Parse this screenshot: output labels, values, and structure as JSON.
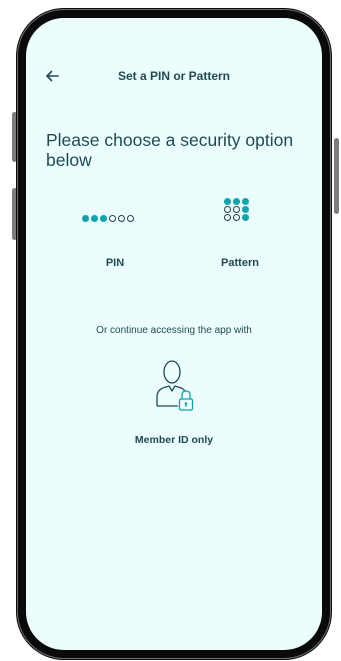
{
  "header": {
    "back_icon": "arrow-left-icon",
    "title": "Set a PIN or Pattern"
  },
  "heading": "Please choose a security option below",
  "options": {
    "pin": {
      "label": "PIN",
      "icon": "pin-dots-icon",
      "filled_dots": 3,
      "total_dots": 6
    },
    "pattern": {
      "label": "Pattern",
      "icon": "pattern-grid-icon"
    }
  },
  "continue_text": "Or continue accessing the app with",
  "member": {
    "label": "Member ID only",
    "icon": "user-lock-icon"
  },
  "colors": {
    "accent": "#0aa5aa",
    "text": "#1f4a52",
    "background": "#ecfdfd"
  }
}
